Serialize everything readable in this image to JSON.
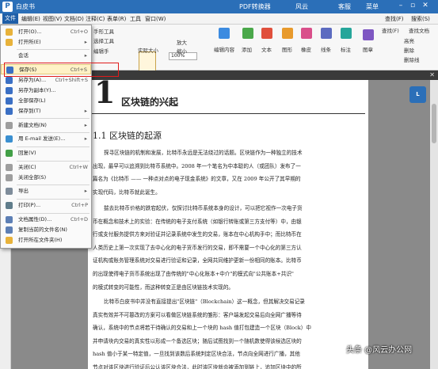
{
  "titlebar": {
    "logo": "P",
    "title": "白皮书",
    "pdf_converter": "PDF转换器",
    "user": "风云",
    "service": "客服",
    "menu": "菜单"
  },
  "menubar": {
    "items": [
      "文件",
      "编辑(E)",
      "视图(V)",
      "文档(D)",
      "注释(C)",
      "表单(R)",
      "工具",
      "窗口(W)"
    ],
    "find": "查找(F)",
    "search": "搜索(S)"
  },
  "toolbar": {
    "items": [
      "手形工具",
      "选择工具",
      "编辑手",
      "实际大小",
      "放大",
      "缩小",
      "编辑内容",
      "添加",
      "文本",
      "图形",
      "橡皮",
      "线条",
      "标注",
      "图章",
      "高亮",
      "删除",
      "删除线"
    ],
    "zoom_value": "100%",
    "find_label": "查找(F)",
    "find_text_label": "查找文档"
  },
  "file_menu": {
    "items": [
      {
        "label": "打开(O)...",
        "shortcut": "Ctrl+O",
        "arrow": ""
      },
      {
        "label": "打开所(E)",
        "shortcut": "",
        "arrow": "▸"
      },
      {
        "label": "会话",
        "shortcut": "",
        "arrow": "▸"
      },
      {
        "label": "保存(S)",
        "shortcut": "Ctrl+S",
        "arrow": ""
      },
      {
        "label": "另存为(A)...",
        "shortcut": "Ctrl+Shift+S",
        "arrow": ""
      },
      {
        "label": "另存为副本(Y)...",
        "shortcut": "",
        "arrow": ""
      },
      {
        "label": "全部保存(L)",
        "shortcut": "",
        "arrow": ""
      },
      {
        "label": "保存到(T)",
        "shortcut": "",
        "arrow": "▸"
      },
      {
        "label": "新建文档(N)",
        "shortcut": "",
        "arrow": "▸"
      },
      {
        "label": "用 E-mail 发送(E)...",
        "shortcut": "",
        "arrow": "▸"
      },
      {
        "label": "回复(V)",
        "shortcut": "",
        "arrow": ""
      },
      {
        "label": "关闭(C)",
        "shortcut": "Ctrl+W",
        "arrow": ""
      },
      {
        "label": "关闭全部(S)",
        "shortcut": "",
        "arrow": ""
      },
      {
        "label": "导出",
        "shortcut": "",
        "arrow": "▸"
      },
      {
        "label": "打印(P)...",
        "shortcut": "Ctrl+P",
        "arrow": ""
      },
      {
        "label": "文档属性(D)...",
        "shortcut": "Ctrl+D",
        "arrow": ""
      },
      {
        "label": "复制当前的文件名(N)",
        "shortcut": "",
        "arrow": ""
      },
      {
        "label": "打开所在文件夹(H)",
        "shortcut": "",
        "arrow": ""
      }
    ]
  },
  "document": {
    "chapter_number": "1",
    "chapter_title": "区块链的兴起",
    "section": "1.1 区块链的起源",
    "para1": [
      "探寻区块链的机制和发展，比特币永远是无法绕过的话题。区块链作为一种独立的技术",
      "出现，最早可以追溯到比特币系统中。2008 年一个笔名为中本聪的人（或团队）发布了一",
      "篇名为《比特币 —— 一种点对点的电子现金系统》的文章，又在 2009 年公开了其早期的",
      "实现代码，比特币就此诞生。"
    ],
    "para2": [
      "揣去比特币价格的跌宕起伏，仅探讨比特币系统本身的设计，可以把它视作一次电子货",
      "币在概念和技术上的实验：在传统的电子支付系统（如银行转账或第三方支付等）中，由银",
      "行或支付服务提供方来对验证并记录系统中发生的交易，账本在中心机构手中；而比特币在",
      "人类历史上第一次实现了去中心化的电子货币发行的交易，即不需要一个中心化的第三方认",
      "证机构或账务管理系统对交易进行验证和记录，全网共同维护更新一份相同的账本。比特币",
      "的出现使得电子货币系统出现了由传统的\"中心化账本+中介\"的模式向\"公共账本+共识\"",
      "的模式转变的可能性，而这种转变正是由区块链技术实现的。"
    ],
    "para3": [
      "比特币白皮书中并没有直接提出\"区块链\"（Blockchain）这一概念，但其解决交易记录",
      "真实有效并不可篡改的方案可以看做区块链系统的雏形：客户端发起交易后向全网广播等待",
      "确认，系统中的节点将若干待确认的交易和上一个块的 hash 值打包建造一个区块（Block）中",
      "并申请块内交易的真实性以形成一个备选区块；随后试图找到一个随机数使得该候选区块的",
      "hash 值小于某一特定值，一旦找到该数后系统判定区块合法，节点向全网进行广播，其他",
      "节点对该区块进行验证后公认该区块合法，此时该区块就会被添加到链上，追加区块中的所",
      "有交易也自然被判定为有效。此后发生的交易则依托该新链在该区块之后，以此形成一个"
    ]
  },
  "float_button": "L",
  "watermark": "头条 @风云办公网"
}
